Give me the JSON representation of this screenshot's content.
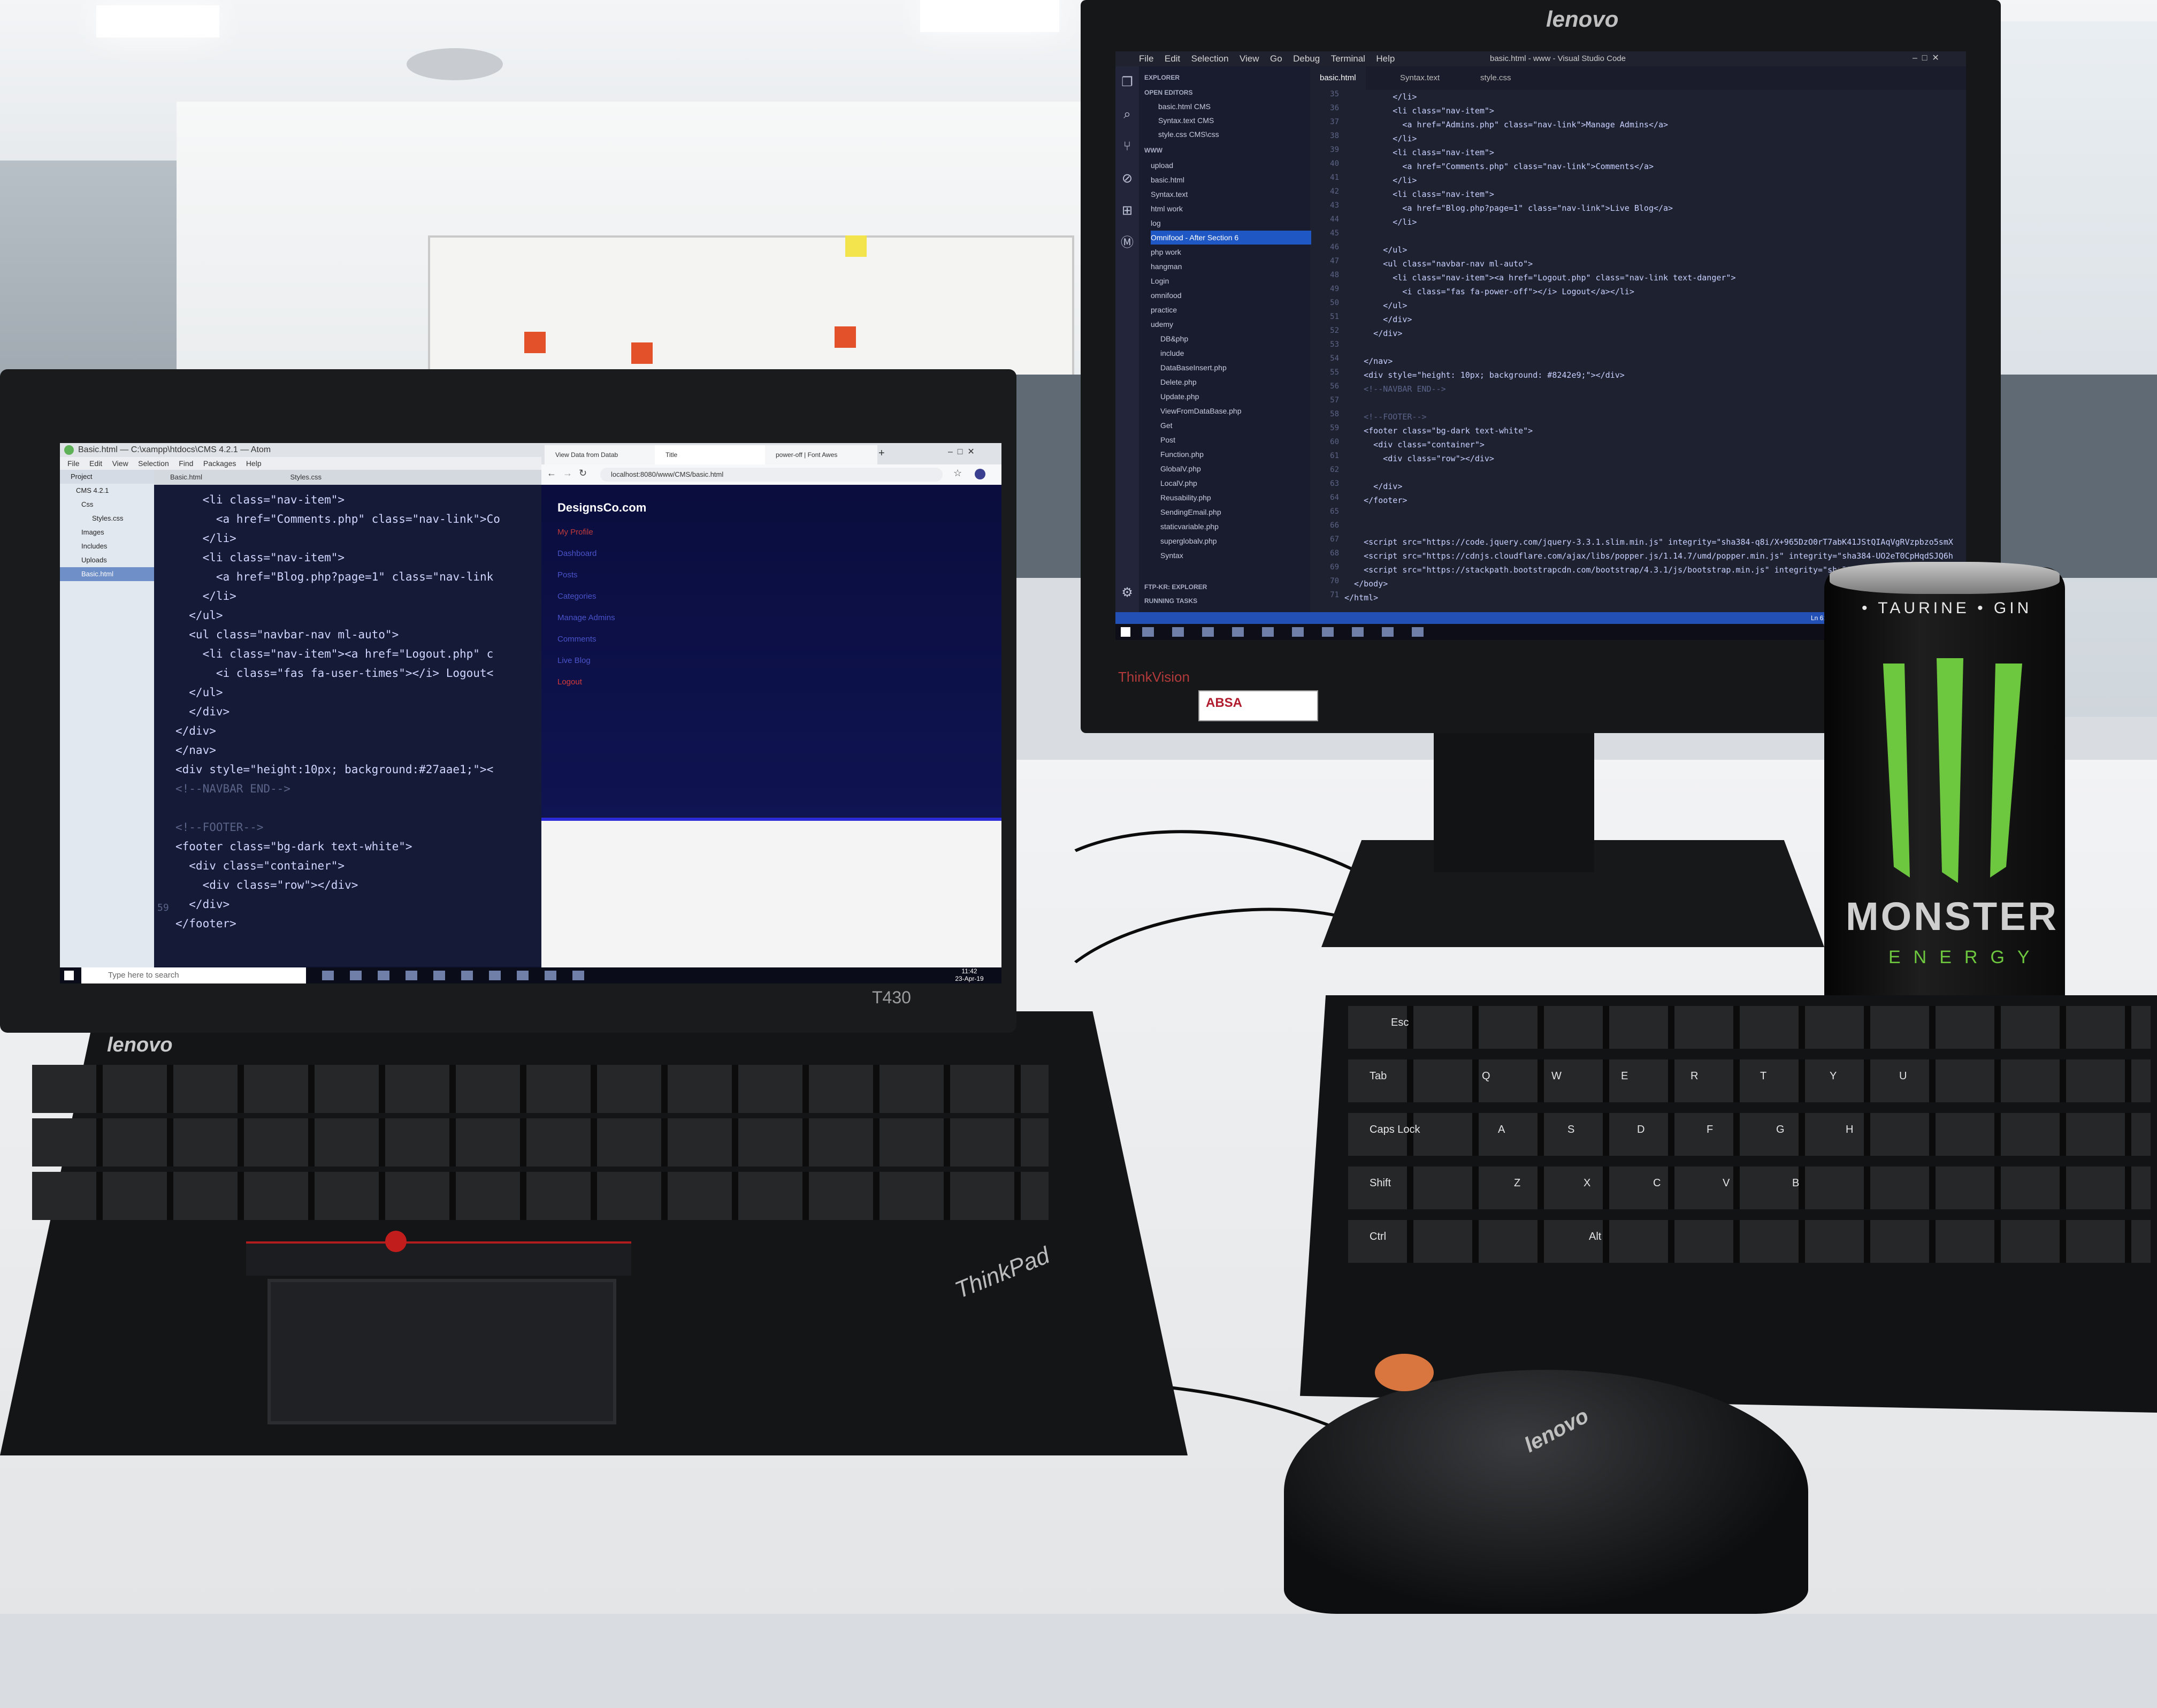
{
  "laptop": {
    "brand": "lenovo",
    "model": "T430",
    "logo": "ThinkPad",
    "atom": {
      "title": "Basic.html — C:\\xampp\\htdocs\\CMS 4.2.1 — Atom",
      "menu": [
        "File",
        "Edit",
        "View",
        "Selection",
        "Find",
        "Packages",
        "Help"
      ],
      "tree_header": "Project",
      "tree": [
        "CMS 4.2.1",
        "Css",
        "Styles.css",
        "Images",
        "Includes",
        "Uploads",
        "Basic.html"
      ],
      "tabs": [
        "Basic.html",
        "Styles.css"
      ],
      "line_number": "59",
      "code": [
        "    <li class=\"nav-item\">",
        "      <a href=\"Comments.php\" class=\"nav-link\">Co",
        "    </li>",
        "    <li class=\"nav-item\">",
        "      <a href=\"Blog.php?page=1\" class=\"nav-link",
        "    </li>",
        "  </ul>",
        "  <ul class=\"navbar-nav ml-auto\">",
        "    <li class=\"nav-item\"><a href=\"Logout.php\" c",
        "      <i class=\"fas fa-user-times\"></i> Logout<",
        "  </ul>",
        "  </div>",
        "</div>",
        "</nav>",
        "<div style=\"height:10px; background:#27aae1;\"><",
        "<!--NAVBAR END-->",
        "",
        "<!--FOOTER-->",
        "<footer class=\"bg-dark text-white\">",
        "  <div class=\"container\">",
        "    <div class=\"row\"></div>",
        "  </div>",
        "</footer>"
      ]
    },
    "browser": {
      "tabs": [
        "View Data from Datab",
        "Title",
        "power-off | Font Awes"
      ],
      "url": "localhost:8080/www/CMS/basic.html",
      "brand": "DesignsCo.com",
      "nav_links": [
        "My Profile",
        "Dashboard",
        "Posts",
        "Categories",
        "Manage Admins",
        "Comments",
        "Live Blog",
        "Logout"
      ]
    },
    "taskbar": {
      "search_placeholder": "Type here to search",
      "time": "11:42",
      "date": "23-Apr-19"
    }
  },
  "monitor": {
    "brand": "lenovo",
    "thinkvision": "ThinkVision",
    "sticker": "ABSA",
    "vscode": {
      "menu": [
        "File",
        "Edit",
        "Selection",
        "View",
        "Go",
        "Debug",
        "Terminal",
        "Help"
      ],
      "title": "basic.html - www - Visual Studio Code",
      "tabs": [
        "basic.html",
        "Syntax.text",
        "style.css"
      ],
      "sidebar_title": "EXPLORER",
      "open_editors_label": "OPEN EDITORS",
      "open_editors": [
        "basic.html CMS",
        "Syntax.text CMS",
        "style.css CMS\\css"
      ],
      "workspace_label": "WWW",
      "files": [
        "upload",
        "basic.html",
        "Syntax.text",
        "html work",
        "log",
        "Omnifood - After Section 6",
        "php work",
        "hangman",
        "Login",
        "omnifood",
        "practice",
        "udemy",
        "DB&php",
        "include",
        "DataBaseInsert.php",
        "Delete.php",
        "Update.php",
        "ViewFromDataBase.php",
        "Get",
        "Post",
        "Function.php",
        "GlobalV.php",
        "LocalV.php",
        "Reusability.php",
        "SendingEmail.php",
        "staticvariable.php",
        "superglobalv.php",
        "Syntax"
      ],
      "panel_labels": [
        "FTP-KR: EXPLORER",
        "RUNNING TASKS"
      ],
      "selected_file_index": 5,
      "line_numbers": [
        "35",
        "36",
        "37",
        "38",
        "39",
        "40",
        "41",
        "42",
        "43",
        "44",
        "45",
        "46",
        "47",
        "48",
        "49",
        "50",
        "51",
        "52",
        "53",
        "54",
        "55",
        "56",
        "57",
        "58",
        "59",
        "60",
        "61",
        "62",
        "63",
        "64",
        "65",
        "66",
        "67",
        "68",
        "69",
        "70",
        "71"
      ],
      "code": [
        "          </li>",
        "          <li class=\"nav-item\">",
        "            <a href=\"Admins.php\" class=\"nav-link\">Manage Admins</a>",
        "          </li>",
        "          <li class=\"nav-item\">",
        "            <a href=\"Comments.php\" class=\"nav-link\">Comments</a>",
        "          </li>",
        "          <li class=\"nav-item\">",
        "            <a href=\"Blog.php?page=1\" class=\"nav-link\">Live Blog</a>",
        "          </li>",
        "",
        "        </ul>",
        "        <ul class=\"navbar-nav ml-auto\">",
        "          <li class=\"nav-item\"><a href=\"Logout.php\" class=\"nav-link text-danger\">",
        "            <i class=\"fas fa-power-off\"></i> Logout</a></li>",
        "        </ul>",
        "        </div>",
        "      </div>",
        "",
        "    </nav>",
        "    <div style=\"height: 10px; background: #8242e9;\"></div>",
        "    <!--NAVBAR END-->",
        "",
        "    <!--FOOTER-->",
        "    <footer class=\"bg-dark text-white\">",
        "      <div class=\"container\">",
        "        <div class=\"row\"></div>",
        "",
        "      </div>",
        "    </footer>",
        "",
        "",
        "    <script src=\"https://code.jquery.com/jquery-3.3.1.slim.min.js\" integrity=\"sha384-q8i/X+965DzO0rT7abK41JStQIAqVgRVzpbzo5smX",
        "    <script src=\"https://cdnjs.cloudflare.com/ajax/libs/popper.js/1.14.7/umd/popper.min.js\" integrity=\"sha384-UO2eT0CpHqdSJQ6h",
        "    <script src=\"https://stackpath.bootstrapcdn.com/bootstrap/4.3.1/js/bootstrap.min.js\" integrity=\"sha384-JjSmVgyd0p3pXB1rRi",
        "  </body>",
        "</html>"
      ],
      "status_position": "Ln 61, Col 34"
    }
  },
  "can": {
    "top_text": "• TAURINE • GIN",
    "name": "MONSTER",
    "energy": "ENERGY",
    "claw_color": "#6ec83f"
  },
  "keyboard": {
    "keys": [
      "Esc",
      "Tab",
      "Caps Lock",
      "Shift",
      "Ctrl",
      "Alt",
      "Q",
      "W",
      "E",
      "R",
      "T",
      "Y",
      "U",
      "A",
      "S",
      "D",
      "F",
      "G",
      "H",
      "Z",
      "X",
      "C",
      "V",
      "B"
    ]
  },
  "mouse": {
    "brand": "lenovo",
    "wheel_color": "#d9763f"
  }
}
